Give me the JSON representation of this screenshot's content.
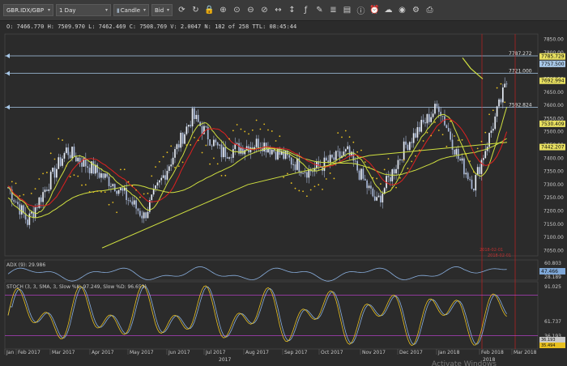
{
  "toolbar": {
    "symbol": "GBR.IDX/GBP",
    "timeframe": "1 Day",
    "chart_type": "Candle",
    "price_type": "Bid",
    "icons": [
      "refresh-icon",
      "sync-icon",
      "lock-icon",
      "zoom-in-icon",
      "zoom-fit-icon",
      "zoom-out-icon",
      "zoom-reset-icon",
      "arrows-h-icon",
      "arrows-v-icon",
      "function-icon",
      "pencil-icon",
      "layers-icon",
      "templates-icon",
      "info-icon",
      "alarm-icon",
      "cloud-icon",
      "camera-icon",
      "settings-icon",
      "print-icon"
    ]
  },
  "info_line": "O: 7466.770 H: 7509.970 L: 7462.469 C: 7508.769 V: 2.0047 N: 182 of 258 TTL: 08:45:44",
  "price_axis": {
    "ticks": [
      "7850.00",
      "7800.00",
      "7750.00",
      "7700.00",
      "7650.00",
      "7600.00",
      "7550.00",
      "7500.00",
      "7450.00",
      "7400.00",
      "7350.00",
      "7300.00",
      "7250.00",
      "7200.00",
      "7150.00",
      "7100.00",
      "7050.00"
    ],
    "tags": [
      {
        "text": "7785.729",
        "color": "#e8e060"
      },
      {
        "text": "7757.500",
        "color": "#a8c8e8"
      },
      {
        "text": "7692.994",
        "color": "#e8e060"
      },
      {
        "text": "7530.409",
        "color": "#e8e060"
      },
      {
        "text": "7442.207",
        "color": "#e8e060"
      }
    ]
  },
  "hlines": [
    {
      "label": "7787.272",
      "value": 7787.272
    },
    {
      "label": "7721.000",
      "value": 7721.0
    },
    {
      "label": "7592.824",
      "value": 7592.824
    }
  ],
  "vline_labels": [
    "2018-02-01",
    "2018-02-01"
  ],
  "adx": {
    "label": "ADX (9): 29.986",
    "ticks": [
      "60.803",
      "28.189"
    ],
    "tag": "47.466"
  },
  "stoch": {
    "label": "STOCH (3, 3, SMA, 3, Slow %K: 97.249, Slow %D: 96.653)",
    "ticks": [
      "91.025",
      "61.737",
      "36.193"
    ],
    "tags": [
      "36.193",
      "35.494"
    ]
  },
  "time_axis": {
    "labels": [
      "Jan",
      "Feb 2017",
      "Mar 2017",
      "Apr 2017",
      "May 2017",
      "Jun 2017",
      "Jul 2017",
      "Aug 2017",
      "Sep 2017",
      "Oct 2017",
      "Nov 2017",
      "Dec 2017",
      "Jan 2018",
      "Feb 2018",
      "Mar 2018"
    ],
    "year_labels": [
      "2017",
      "2018"
    ]
  },
  "watermark": "Activate Windows",
  "colors": {
    "background": "#2b2b2b",
    "candles": "#a8b8d8",
    "sma_fast": "#d0e040",
    "sma_red": "#e02020",
    "sar": "#e8c020",
    "hline": "#a8c8e8",
    "vline": "#c02020",
    "adx": "#8ab0e0",
    "stoch_k": "#e8c020",
    "stoch_d": "#8ab0e0",
    "stoch_levels": "#b040c0"
  }
}
